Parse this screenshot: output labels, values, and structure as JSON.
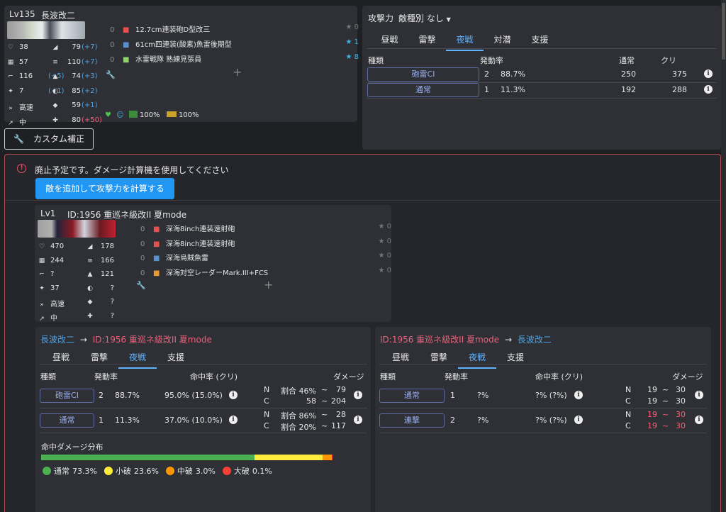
{
  "ship": {
    "level": "Lv135",
    "name": "長波改二",
    "stats_left": [
      {
        "icon": "heart-icon",
        "glyph": "♡",
        "value": "38"
      },
      {
        "icon": "armor-icon",
        "glyph": "▦",
        "value": "57"
      },
      {
        "icon": "firepower-icon",
        "glyph": "⌐",
        "value": "116",
        "bonus": "(+5)"
      },
      {
        "icon": "aa-icon",
        "glyph": "✦",
        "value": "7",
        "bonus": "(+1)"
      },
      {
        "icon": "speed-icon",
        "glyph": "»",
        "value": "高速"
      },
      {
        "icon": "range-icon",
        "glyph": "↗",
        "value": "中"
      }
    ],
    "stats_right": [
      {
        "icon": "evasion-icon",
        "glyph": "◢",
        "value": "79",
        "bonus": "(+7)",
        "bonus_color": "blue"
      },
      {
        "icon": "torpedo-icon",
        "glyph": "≡",
        "value": "110",
        "bonus": "(+7)",
        "bonus_color": "blue"
      },
      {
        "icon": "asw-icon",
        "glyph": "▲",
        "value": "74",
        "bonus": "(+3)",
        "bonus_color": "blue"
      },
      {
        "icon": "los-icon",
        "glyph": "◐",
        "value": "85",
        "bonus": "(+2)",
        "bonus_color": "blue"
      },
      {
        "icon": "luck-icon",
        "glyph": "◆",
        "value": "59",
        "bonus": "(+1)",
        "bonus_color": "blue"
      },
      {
        "icon": "accuracy-icon",
        "glyph": "✚",
        "value": "80",
        "bonus": "(+50)",
        "bonus_color": "pink"
      }
    ],
    "equipment": [
      {
        "slot": "0",
        "name": "12.7cm連装砲D型改三",
        "icon": "gun-icon",
        "color": "#e85050",
        "star": "★ 0",
        "star_color": "#777"
      },
      {
        "slot": "0",
        "name": "61cm四連装(酸素)魚雷後期型",
        "icon": "torpedo-equip-icon",
        "color": "#5a8fd0",
        "star": "★ 1",
        "star_color": "#3ab6e8"
      },
      {
        "slot": "0",
        "name": "水雷戦隊 熟練見張員",
        "icon": "lookout-icon",
        "color": "#8fd070",
        "star": "★ 8",
        "star_color": "#3ab6e8"
      }
    ],
    "status": {
      "fuel": "100%",
      "ammo": "100%"
    }
  },
  "custom_button": "カスタム補正",
  "attack_panel": {
    "title": "攻撃力",
    "enemy_type_label": "敵種別 なし",
    "tabs": [
      "昼戦",
      "雷撃",
      "夜戦",
      "対潜",
      "支援"
    ],
    "active_tab": 2,
    "headers": [
      "種類",
      "発動率",
      "通常",
      "クリ"
    ],
    "rows": [
      {
        "type": "砲雷CI",
        "count": "2",
        "rate": "88.7%",
        "normal": "250",
        "crit": "375"
      },
      {
        "type": "通常",
        "count": "1",
        "rate": "11.3%",
        "normal": "192",
        "crit": "288"
      }
    ]
  },
  "warning": {
    "text": "廃止予定です。ダメージ計算機を使用してください",
    "button": "敵を追加して攻撃力を計算する"
  },
  "enemy": {
    "level": "Lv1",
    "name": "ID:1956 重巡ネ級改II 夏mode",
    "stats_left": [
      {
        "icon": "heart-icon",
        "glyph": "♡",
        "value": "470"
      },
      {
        "icon": "armor-icon",
        "glyph": "▦",
        "value": "244"
      },
      {
        "icon": "firepower-icon",
        "glyph": "⌐",
        "value": "?"
      },
      {
        "icon": "aa-icon",
        "glyph": "✦",
        "value": "37"
      },
      {
        "icon": "speed-icon",
        "glyph": "»",
        "value": "高速"
      },
      {
        "icon": "range-icon",
        "glyph": "↗",
        "value": "中"
      }
    ],
    "stats_right": [
      {
        "icon": "evasion-icon",
        "glyph": "◢",
        "value": "178"
      },
      {
        "icon": "torpedo-icon",
        "glyph": "≡",
        "value": "166"
      },
      {
        "icon": "asw-icon",
        "glyph": "▲",
        "value": "121"
      },
      {
        "icon": "los-icon",
        "glyph": "◐",
        "value": "?"
      },
      {
        "icon": "luck-icon",
        "glyph": "◆",
        "value": "?"
      },
      {
        "icon": "accuracy-icon",
        "glyph": "✚",
        "value": "?"
      }
    ],
    "equipment": [
      {
        "slot": "0",
        "name": "深海8inch連装速射砲",
        "icon": "gun-icon",
        "color": "#e85050",
        "star": "★ 0"
      },
      {
        "slot": "0",
        "name": "深海8inch連装速射砲",
        "icon": "gun-icon",
        "color": "#e85050",
        "star": "★ 0"
      },
      {
        "slot": "0",
        "name": "深海烏賊魚雷",
        "icon": "torpedo-equip-icon",
        "color": "#5a8fd0",
        "star": "★ 0"
      },
      {
        "slot": "0",
        "name": "深海対空レーダーMark.III+FCS",
        "icon": "radar-icon",
        "color": "#e89a30",
        "star": "★ 0"
      }
    ]
  },
  "left_result": {
    "from": "長波改二",
    "arrow": "→",
    "to": "ID:1956 重巡ネ級改II 夏mode",
    "tabs": [
      "昼戦",
      "雷撃",
      "夜戦",
      "支援"
    ],
    "active_tab": 2,
    "headers": [
      "種類",
      "発動率",
      "命中率 (クリ)",
      "ダメージ"
    ],
    "rows": [
      {
        "type": "砲雷CI",
        "count": "2",
        "rate": "88.7%",
        "hit": "95.0% (15.0%)",
        "n": "N",
        "n_text": "割合 46%",
        "n_sep": "~",
        "n_val": "79",
        "c": "C",
        "c_text": "58",
        "c_sep": "~",
        "c_val": "204"
      },
      {
        "type": "通常",
        "count": "1",
        "rate": "11.3%",
        "hit": "37.0% (10.0%)",
        "n": "N",
        "n_text": "割合 86%",
        "n_sep": "~",
        "n_val": "28",
        "c": "C",
        "c_text": "割合 20%",
        "c_sep": "~",
        "c_val": "117"
      }
    ],
    "distribution_title": "命中ダメージ分布",
    "distribution": [
      {
        "label": "通常",
        "value": "73.3%",
        "pct": 73.3,
        "color": "#4caf50"
      },
      {
        "label": "小破",
        "value": "23.6%",
        "pct": 23.6,
        "color": "#ffeb3b"
      },
      {
        "label": "中破",
        "value": "3.0%",
        "pct": 3.0,
        "color": "#ff9800"
      },
      {
        "label": "大破",
        "value": "0.1%",
        "pct": 0.1,
        "color": "#f44336"
      }
    ]
  },
  "right_result": {
    "from": "ID:1956 重巡ネ級改II 夏mode",
    "arrow": "→",
    "to": "長波改二",
    "tabs": [
      "昼戦",
      "雷撃",
      "夜戦",
      "支援"
    ],
    "active_tab": 2,
    "headers": [
      "種類",
      "発動率",
      "命中率 (クリ)",
      "ダメージ"
    ],
    "rows": [
      {
        "type": "通常",
        "count": "1",
        "rate": "?%",
        "hit": "?% (?%)",
        "n": "N",
        "n_a": "19",
        "n_sep": "~",
        "n_b": "30",
        "c": "C",
        "c_a": "19",
        "c_sep": "~",
        "c_b": "30"
      },
      {
        "type": "連撃",
        "count": "2",
        "rate": "?%",
        "hit": "?% (?%)",
        "n": "N",
        "n_a": "19",
        "n_sep": "~",
        "n_b": "30",
        "c": "C",
        "c_a": "19",
        "c_sep": "~",
        "c_b": "30"
      }
    ]
  }
}
